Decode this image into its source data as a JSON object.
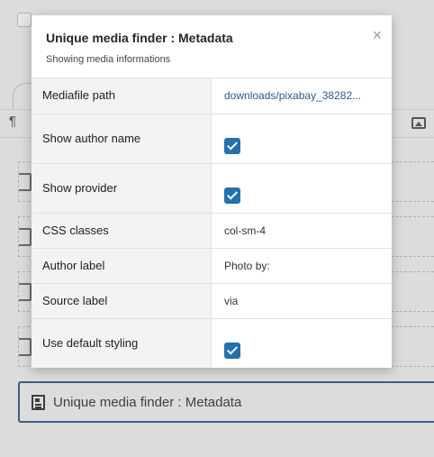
{
  "modal": {
    "title": "Unique media finder : Metadata",
    "subtitle": "Showing media informations",
    "close_icon": "×",
    "rows": [
      {
        "label": "Mediafile path",
        "value": "downloads/pixabay_38282..."
      },
      {
        "label": "Show author name",
        "checked": true
      },
      {
        "label": "Show provider",
        "checked": true
      },
      {
        "label": "CSS classes",
        "value": "col-sm-4"
      },
      {
        "label": "Author label",
        "value": "Photo by:"
      },
      {
        "label": "Source label",
        "value": "via"
      },
      {
        "label": "Use default styling",
        "checked": true
      }
    ]
  },
  "editor": {
    "paragraph_icon": "¶",
    "selected_block_title": "Unique media finder : Metadata"
  },
  "colors": {
    "checkbox": "#2271b1",
    "selected_block_border": "#3b5e86",
    "overlay": "#dcdcdc"
  }
}
